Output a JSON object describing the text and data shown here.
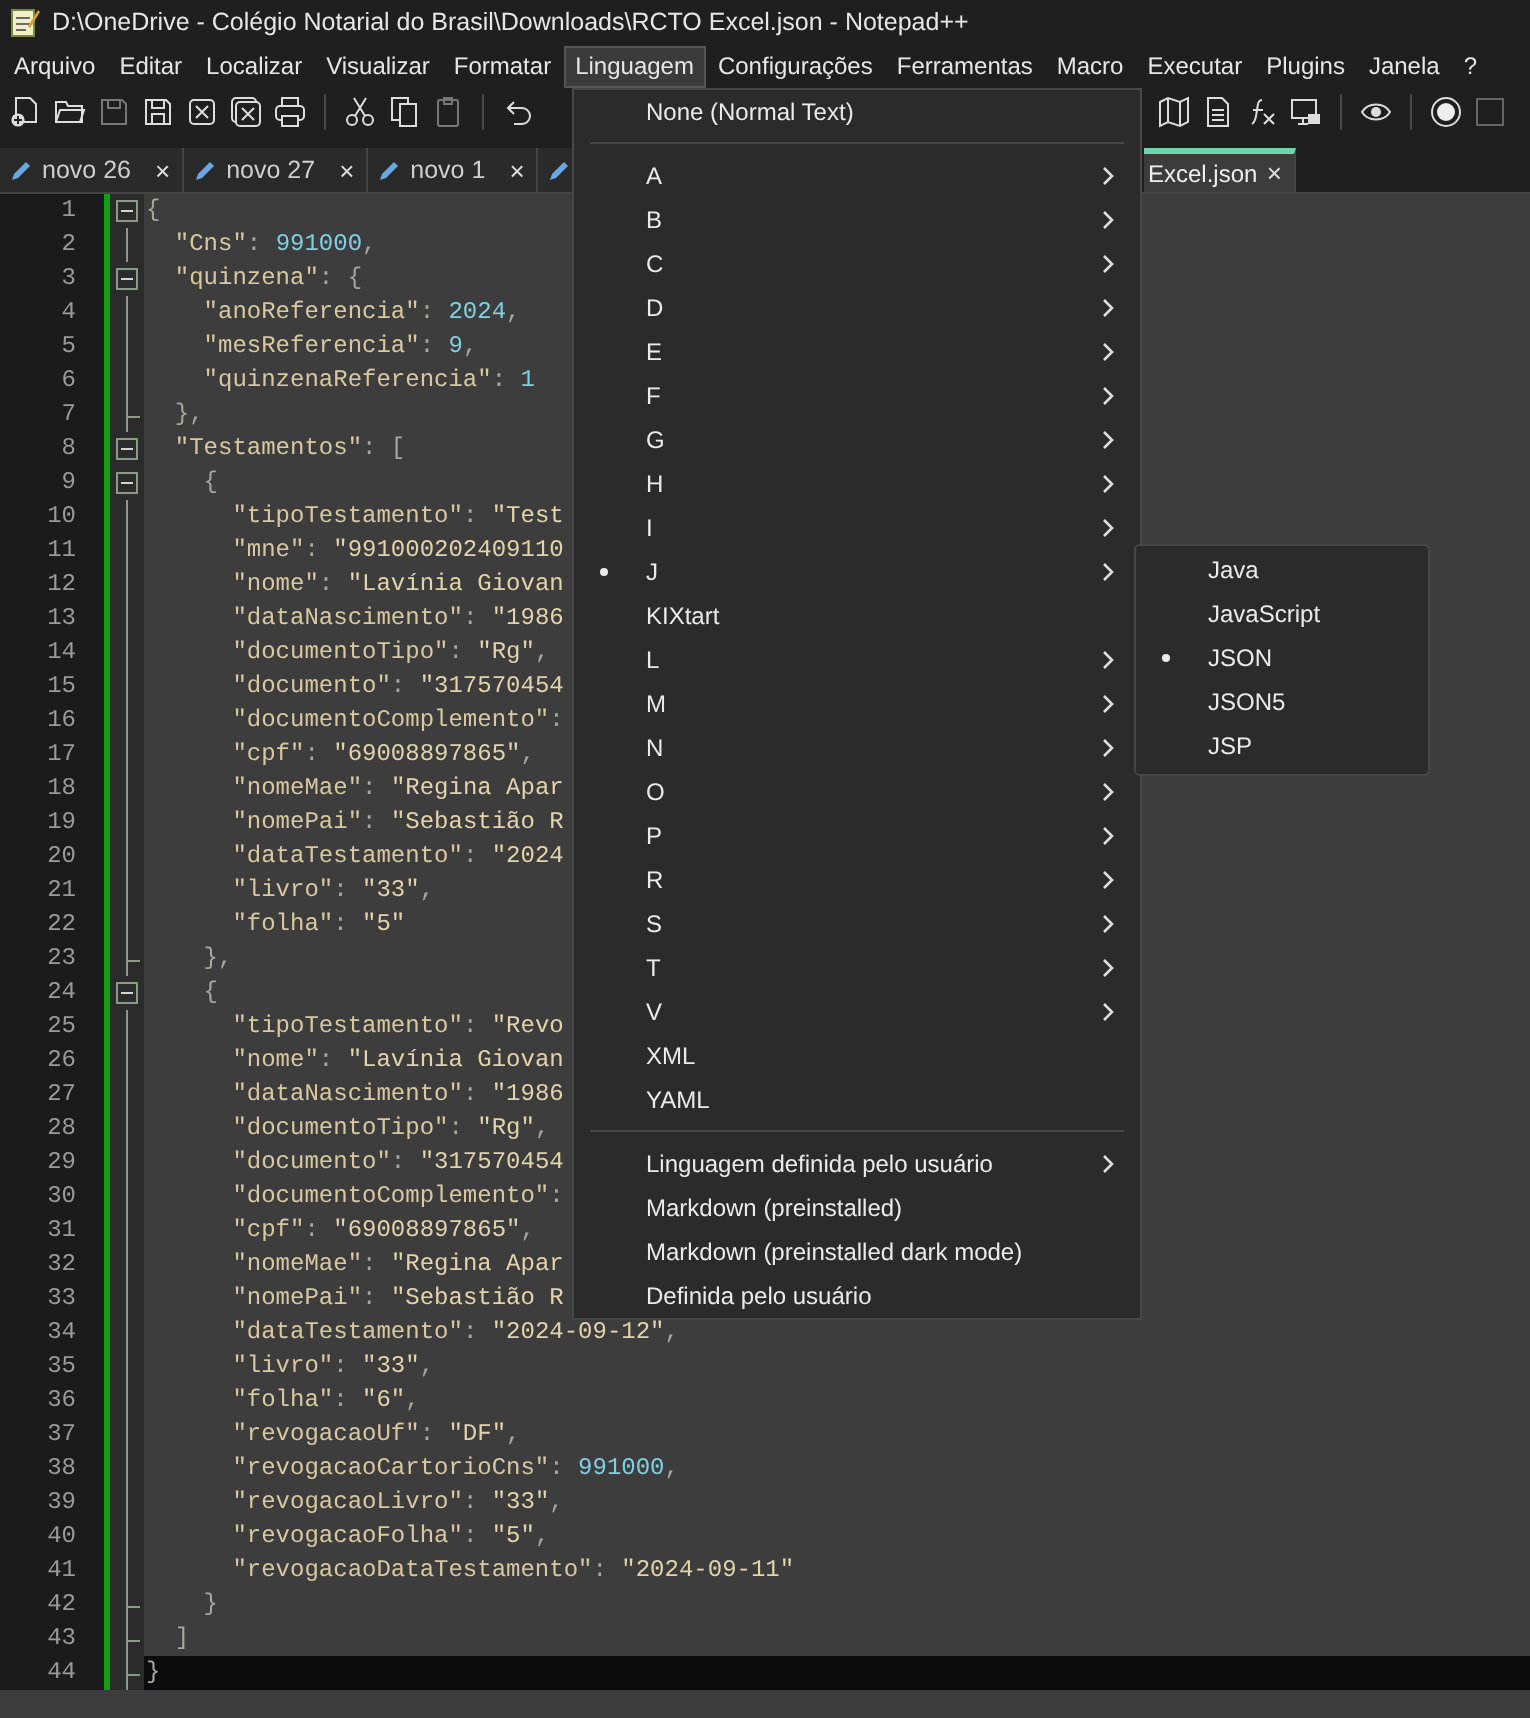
{
  "window": {
    "title": "D:\\OneDrive - Colégio Notarial do Brasil\\Downloads\\RCTO Excel.json - Notepad++"
  },
  "menu_bar": [
    {
      "label": "Arquivo",
      "selected": false
    },
    {
      "label": "Editar",
      "selected": false
    },
    {
      "label": "Localizar",
      "selected": false
    },
    {
      "label": "Visualizar",
      "selected": false
    },
    {
      "label": "Formatar",
      "selected": false
    },
    {
      "label": "Linguagem",
      "selected": true
    },
    {
      "label": "Configurações",
      "selected": false
    },
    {
      "label": "Ferramentas",
      "selected": false
    },
    {
      "label": "Macro",
      "selected": false
    },
    {
      "label": "Executar",
      "selected": false
    },
    {
      "label": "Plugins",
      "selected": false
    },
    {
      "label": "Janela",
      "selected": false
    },
    {
      "label": "?",
      "selected": false
    }
  ],
  "tabs": [
    {
      "label": "novo 26",
      "close": "×",
      "selected": false
    },
    {
      "label": "novo 27",
      "close": "×",
      "selected": false
    },
    {
      "label": "novo 1",
      "close": "×",
      "selected": false
    },
    {
      "selected": false
    }
  ],
  "active_tab": {
    "label": "Excel.json",
    "close": "×",
    "selected": true
  },
  "editor": {
    "lines": [
      {
        "number": "1",
        "fold_toggle": true,
        "fold_end": false,
        "current": false,
        "tokens": [
          {
            "kind": "p",
            "text": "{"
          }
        ]
      },
      {
        "number": "2",
        "fold_toggle": false,
        "fold_end": false,
        "current": false,
        "tokens": [
          {
            "kind": "k",
            "text": "  \"Cns\""
          },
          {
            "kind": "p",
            "text": ": "
          },
          {
            "kind": "n",
            "text": "991000"
          },
          {
            "kind": "p",
            "text": ","
          }
        ]
      },
      {
        "number": "3",
        "fold_toggle": true,
        "fold_end": false,
        "current": false,
        "tokens": [
          {
            "kind": "k",
            "text": "  \"quinzena\""
          },
          {
            "kind": "p",
            "text": ": {"
          }
        ]
      },
      {
        "number": "4",
        "fold_toggle": false,
        "fold_end": false,
        "current": false,
        "tokens": [
          {
            "kind": "k",
            "text": "    \"anoReferencia\""
          },
          {
            "kind": "p",
            "text": ": "
          },
          {
            "kind": "n",
            "text": "2024"
          },
          {
            "kind": "p",
            "text": ","
          }
        ]
      },
      {
        "number": "5",
        "fold_toggle": false,
        "fold_end": false,
        "current": false,
        "tokens": [
          {
            "kind": "k",
            "text": "    \"mesReferencia\""
          },
          {
            "kind": "p",
            "text": ": "
          },
          {
            "kind": "n",
            "text": "9"
          },
          {
            "kind": "p",
            "text": ","
          }
        ]
      },
      {
        "number": "6",
        "fold_toggle": false,
        "fold_end": false,
        "current": false,
        "tokens": [
          {
            "kind": "k",
            "text": "    \"quinzenaReferencia\""
          },
          {
            "kind": "p",
            "text": ": "
          },
          {
            "kind": "n",
            "text": "1"
          }
        ]
      },
      {
        "number": "7",
        "fold_toggle": false,
        "fold_end": true,
        "current": false,
        "tokens": [
          {
            "kind": "p",
            "text": "  },"
          }
        ]
      },
      {
        "number": "8",
        "fold_toggle": true,
        "fold_end": false,
        "current": false,
        "tokens": [
          {
            "kind": "k",
            "text": "  \"Testamentos\""
          },
          {
            "kind": "p",
            "text": ": ["
          }
        ]
      },
      {
        "number": "9",
        "fold_toggle": true,
        "fold_end": false,
        "current": false,
        "tokens": [
          {
            "kind": "p",
            "text": "    {"
          }
        ]
      },
      {
        "number": "10",
        "fold_toggle": false,
        "fold_end": false,
        "current": false,
        "tokens": [
          {
            "kind": "k",
            "text": "      \"tipoTestamento\""
          },
          {
            "kind": "p",
            "text": ": "
          },
          {
            "kind": "s",
            "text": "\"Test"
          }
        ]
      },
      {
        "number": "11",
        "fold_toggle": false,
        "fold_end": false,
        "current": false,
        "tokens": [
          {
            "kind": "k",
            "text": "      \"mne\""
          },
          {
            "kind": "p",
            "text": ": "
          },
          {
            "kind": "s",
            "text": "\"991000202409110"
          }
        ]
      },
      {
        "number": "12",
        "fold_toggle": false,
        "fold_end": false,
        "current": false,
        "tokens": [
          {
            "kind": "k",
            "text": "      \"nome\""
          },
          {
            "kind": "p",
            "text": ": "
          },
          {
            "kind": "s",
            "text": "\"Lavínia Giovan"
          }
        ]
      },
      {
        "number": "13",
        "fold_toggle": false,
        "fold_end": false,
        "current": false,
        "tokens": [
          {
            "kind": "k",
            "text": "      \"dataNascimento\""
          },
          {
            "kind": "p",
            "text": ": "
          },
          {
            "kind": "s",
            "text": "\"1986"
          }
        ]
      },
      {
        "number": "14",
        "fold_toggle": false,
        "fold_end": false,
        "current": false,
        "tokens": [
          {
            "kind": "k",
            "text": "      \"documentoTipo\""
          },
          {
            "kind": "p",
            "text": ": "
          },
          {
            "kind": "s",
            "text": "\"Rg\""
          },
          {
            "kind": "p",
            "text": ","
          }
        ]
      },
      {
        "number": "15",
        "fold_toggle": false,
        "fold_end": false,
        "current": false,
        "tokens": [
          {
            "kind": "k",
            "text": "      \"documento\""
          },
          {
            "kind": "p",
            "text": ": "
          },
          {
            "kind": "s",
            "text": "\"317570454"
          }
        ]
      },
      {
        "number": "16",
        "fold_toggle": false,
        "fold_end": false,
        "current": false,
        "tokens": [
          {
            "kind": "k",
            "text": "      \"documentoComplemento\""
          },
          {
            "kind": "p",
            "text": ":"
          }
        ]
      },
      {
        "number": "17",
        "fold_toggle": false,
        "fold_end": false,
        "current": false,
        "tokens": [
          {
            "kind": "k",
            "text": "      \"cpf\""
          },
          {
            "kind": "p",
            "text": ": "
          },
          {
            "kind": "s",
            "text": "\"69008897865\""
          },
          {
            "kind": "p",
            "text": ","
          }
        ]
      },
      {
        "number": "18",
        "fold_toggle": false,
        "fold_end": false,
        "current": false,
        "tokens": [
          {
            "kind": "k",
            "text": "      \"nomeMae\""
          },
          {
            "kind": "p",
            "text": ": "
          },
          {
            "kind": "s",
            "text": "\"Regina Apar"
          }
        ]
      },
      {
        "number": "19",
        "fold_toggle": false,
        "fold_end": false,
        "current": false,
        "tokens": [
          {
            "kind": "k",
            "text": "      \"nomePai\""
          },
          {
            "kind": "p",
            "text": ": "
          },
          {
            "kind": "s",
            "text": "\"Sebastião R"
          }
        ]
      },
      {
        "number": "20",
        "fold_toggle": false,
        "fold_end": false,
        "current": false,
        "tokens": [
          {
            "kind": "k",
            "text": "      \"dataTestamento\""
          },
          {
            "kind": "p",
            "text": ": "
          },
          {
            "kind": "s",
            "text": "\"2024"
          }
        ]
      },
      {
        "number": "21",
        "fold_toggle": false,
        "fold_end": false,
        "current": false,
        "tokens": [
          {
            "kind": "k",
            "text": "      \"livro\""
          },
          {
            "kind": "p",
            "text": ": "
          },
          {
            "kind": "s",
            "text": "\"33\""
          },
          {
            "kind": "p",
            "text": ","
          }
        ]
      },
      {
        "number": "22",
        "fold_toggle": false,
        "fold_end": false,
        "current": false,
        "tokens": [
          {
            "kind": "k",
            "text": "      \"folha\""
          },
          {
            "kind": "p",
            "text": ": "
          },
          {
            "kind": "s",
            "text": "\"5\""
          }
        ]
      },
      {
        "number": "23",
        "fold_toggle": false,
        "fold_end": true,
        "current": false,
        "tokens": [
          {
            "kind": "p",
            "text": "    },"
          }
        ]
      },
      {
        "number": "24",
        "fold_toggle": true,
        "fold_end": false,
        "current": false,
        "tokens": [
          {
            "kind": "p",
            "text": "    {"
          }
        ]
      },
      {
        "number": "25",
        "fold_toggle": false,
        "fold_end": false,
        "current": false,
        "tokens": [
          {
            "kind": "k",
            "text": "      \"tipoTestamento\""
          },
          {
            "kind": "p",
            "text": ": "
          },
          {
            "kind": "s",
            "text": "\"Revo"
          }
        ]
      },
      {
        "number": "26",
        "fold_toggle": false,
        "fold_end": false,
        "current": false,
        "tokens": [
          {
            "kind": "k",
            "text": "      \"nome\""
          },
          {
            "kind": "p",
            "text": ": "
          },
          {
            "kind": "s",
            "text": "\"Lavínia Giovan"
          }
        ]
      },
      {
        "number": "27",
        "fold_toggle": false,
        "fold_end": false,
        "current": false,
        "tokens": [
          {
            "kind": "k",
            "text": "      \"dataNascimento\""
          },
          {
            "kind": "p",
            "text": ": "
          },
          {
            "kind": "s",
            "text": "\"1986"
          }
        ]
      },
      {
        "number": "28",
        "fold_toggle": false,
        "fold_end": false,
        "current": false,
        "tokens": [
          {
            "kind": "k",
            "text": "      \"documentoTipo\""
          },
          {
            "kind": "p",
            "text": ": "
          },
          {
            "kind": "s",
            "text": "\"Rg\""
          },
          {
            "kind": "p",
            "text": ","
          }
        ]
      },
      {
        "number": "29",
        "fold_toggle": false,
        "fold_end": false,
        "current": false,
        "tokens": [
          {
            "kind": "k",
            "text": "      \"documento\""
          },
          {
            "kind": "p",
            "text": ": "
          },
          {
            "kind": "s",
            "text": "\"317570454"
          }
        ]
      },
      {
        "number": "30",
        "fold_toggle": false,
        "fold_end": false,
        "current": false,
        "tokens": [
          {
            "kind": "k",
            "text": "      \"documentoComplemento\""
          },
          {
            "kind": "p",
            "text": ":"
          }
        ]
      },
      {
        "number": "31",
        "fold_toggle": false,
        "fold_end": false,
        "current": false,
        "tokens": [
          {
            "kind": "k",
            "text": "      \"cpf\""
          },
          {
            "kind": "p",
            "text": ": "
          },
          {
            "kind": "s",
            "text": "\"69008897865\""
          },
          {
            "kind": "p",
            "text": ","
          }
        ]
      },
      {
        "number": "32",
        "fold_toggle": false,
        "fold_end": false,
        "current": false,
        "tokens": [
          {
            "kind": "k",
            "text": "      \"nomeMae\""
          },
          {
            "kind": "p",
            "text": ": "
          },
          {
            "kind": "s",
            "text": "\"Regina Apar"
          }
        ]
      },
      {
        "number": "33",
        "fold_toggle": false,
        "fold_end": false,
        "current": false,
        "tokens": [
          {
            "kind": "k",
            "text": "      \"nomePai\""
          },
          {
            "kind": "p",
            "text": ": "
          },
          {
            "kind": "s",
            "text": "\"Sebastião R"
          }
        ]
      },
      {
        "number": "34",
        "fold_toggle": false,
        "fold_end": false,
        "current": false,
        "tokens": [
          {
            "kind": "k",
            "text": "      \"dataTestamento\""
          },
          {
            "kind": "p",
            "text": ": "
          },
          {
            "kind": "s",
            "text": "\"2024-09-12\""
          },
          {
            "kind": "p",
            "text": ","
          }
        ]
      },
      {
        "number": "35",
        "fold_toggle": false,
        "fold_end": false,
        "current": false,
        "tokens": [
          {
            "kind": "k",
            "text": "      \"livro\""
          },
          {
            "kind": "p",
            "text": ": "
          },
          {
            "kind": "s",
            "text": "\"33\""
          },
          {
            "kind": "p",
            "text": ","
          }
        ]
      },
      {
        "number": "36",
        "fold_toggle": false,
        "fold_end": false,
        "current": false,
        "tokens": [
          {
            "kind": "k",
            "text": "      \"folha\""
          },
          {
            "kind": "p",
            "text": ": "
          },
          {
            "kind": "s",
            "text": "\"6\""
          },
          {
            "kind": "p",
            "text": ","
          }
        ]
      },
      {
        "number": "37",
        "fold_toggle": false,
        "fold_end": false,
        "current": false,
        "tokens": [
          {
            "kind": "k",
            "text": "      \"revogacaoUf\""
          },
          {
            "kind": "p",
            "text": ": "
          },
          {
            "kind": "s",
            "text": "\"DF\""
          },
          {
            "kind": "p",
            "text": ","
          }
        ]
      },
      {
        "number": "38",
        "fold_toggle": false,
        "fold_end": false,
        "current": false,
        "tokens": [
          {
            "kind": "k",
            "text": "      \"revogacaoCartorioCns\""
          },
          {
            "kind": "p",
            "text": ": "
          },
          {
            "kind": "n",
            "text": "991000"
          },
          {
            "kind": "p",
            "text": ","
          }
        ]
      },
      {
        "number": "39",
        "fold_toggle": false,
        "fold_end": false,
        "current": false,
        "tokens": [
          {
            "kind": "k",
            "text": "      \"revogacaoLivro\""
          },
          {
            "kind": "p",
            "text": ": "
          },
          {
            "kind": "s",
            "text": "\"33\""
          },
          {
            "kind": "p",
            "text": ","
          }
        ]
      },
      {
        "number": "40",
        "fold_toggle": false,
        "fold_end": false,
        "current": false,
        "tokens": [
          {
            "kind": "k",
            "text": "      \"revogacaoFolha\""
          },
          {
            "kind": "p",
            "text": ": "
          },
          {
            "kind": "s",
            "text": "\"5\""
          },
          {
            "kind": "p",
            "text": ","
          }
        ]
      },
      {
        "number": "41",
        "fold_toggle": false,
        "fold_end": false,
        "current": false,
        "tokens": [
          {
            "kind": "k",
            "text": "      \"revogacaoDataTestamento\""
          },
          {
            "kind": "p",
            "text": ": "
          },
          {
            "kind": "s",
            "text": "\"2024-09-11\""
          }
        ]
      },
      {
        "number": "42",
        "fold_toggle": false,
        "fold_end": true,
        "current": false,
        "tokens": [
          {
            "kind": "p",
            "text": "    }"
          }
        ]
      },
      {
        "number": "43",
        "fold_toggle": false,
        "fold_end": true,
        "current": false,
        "tokens": [
          {
            "kind": "p",
            "text": "  ]"
          }
        ]
      },
      {
        "number": "44",
        "fold_toggle": false,
        "fold_end": true,
        "current": true,
        "tokens": [
          {
            "kind": "p",
            "text": "}"
          }
        ]
      }
    ]
  },
  "language_menu": {
    "items": [
      {
        "kind": "item",
        "label": "None (Normal Text)",
        "submenu": false,
        "checked": false
      },
      {
        "kind": "separator"
      },
      {
        "kind": "item",
        "label": "A",
        "submenu": true,
        "checked": false
      },
      {
        "kind": "item",
        "label": "B",
        "submenu": true,
        "checked": false
      },
      {
        "kind": "item",
        "label": "C",
        "submenu": true,
        "checked": false
      },
      {
        "kind": "item",
        "label": "D",
        "submenu": true,
        "checked": false
      },
      {
        "kind": "item",
        "label": "E",
        "submenu": true,
        "checked": false
      },
      {
        "kind": "item",
        "label": "F",
        "submenu": true,
        "checked": false
      },
      {
        "kind": "item",
        "label": "G",
        "submenu": true,
        "checked": false
      },
      {
        "kind": "item",
        "label": "H",
        "submenu": true,
        "checked": false
      },
      {
        "kind": "item",
        "label": "I",
        "submenu": true,
        "checked": false
      },
      {
        "kind": "item",
        "label": "J",
        "submenu": true,
        "checked": true
      },
      {
        "kind": "item",
        "label": "KIXtart",
        "submenu": false,
        "checked": false
      },
      {
        "kind": "item",
        "label": "L",
        "submenu": true,
        "checked": false
      },
      {
        "kind": "item",
        "label": "M",
        "submenu": true,
        "checked": false
      },
      {
        "kind": "item",
        "label": "N",
        "submenu": true,
        "checked": false
      },
      {
        "kind": "item",
        "label": "O",
        "submenu": true,
        "checked": false
      },
      {
        "kind": "item",
        "label": "P",
        "submenu": true,
        "checked": false
      },
      {
        "kind": "item",
        "label": "R",
        "submenu": true,
        "checked": false
      },
      {
        "kind": "item",
        "label": "S",
        "submenu": true,
        "checked": false
      },
      {
        "kind": "item",
        "label": "T",
        "submenu": true,
        "checked": false
      },
      {
        "kind": "item",
        "label": "V",
        "submenu": true,
        "checked": false
      },
      {
        "kind": "item",
        "label": "XML",
        "submenu": false,
        "checked": false
      },
      {
        "kind": "item",
        "label": "YAML",
        "submenu": false,
        "checked": false
      },
      {
        "kind": "separator"
      },
      {
        "kind": "item",
        "label": "Linguagem definida pelo usuário",
        "submenu": true,
        "checked": false
      },
      {
        "kind": "item",
        "label": "Markdown (preinstalled)",
        "submenu": false,
        "checked": false
      },
      {
        "kind": "item",
        "label": "Markdown (preinstalled dark mode)",
        "submenu": false,
        "checked": false
      },
      {
        "kind": "item",
        "label": "Definida pelo usuário",
        "submenu": false,
        "checked": false
      }
    ]
  },
  "j_submenu": {
    "items": [
      {
        "label": "Java",
        "checked": false
      },
      {
        "label": "JavaScript",
        "checked": false
      },
      {
        "label": "JSON",
        "checked": true
      },
      {
        "label": "JSON5",
        "checked": false
      },
      {
        "label": "JSP",
        "checked": false
      }
    ]
  }
}
